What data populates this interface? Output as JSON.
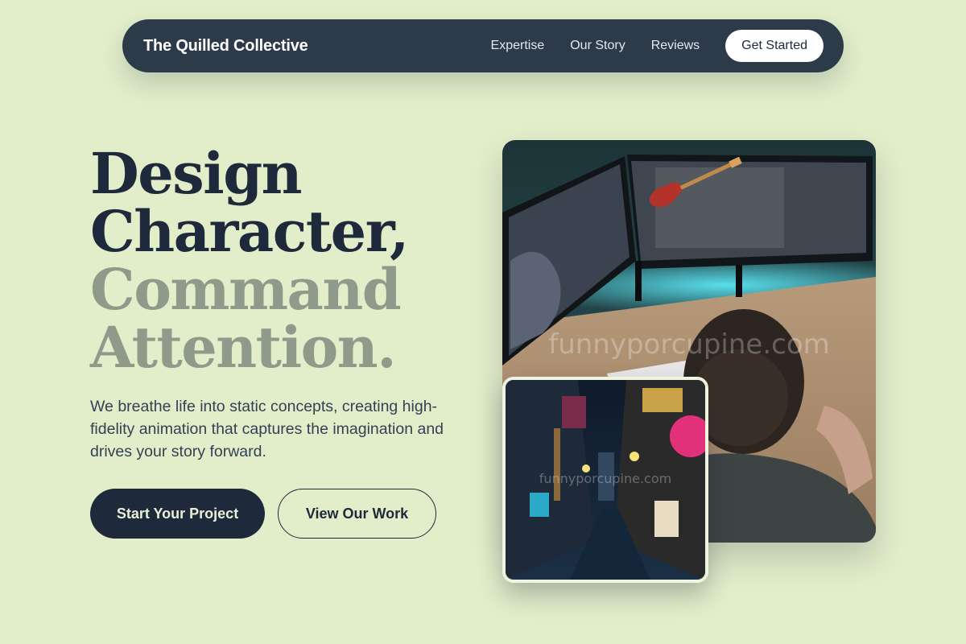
{
  "nav": {
    "brand": "The Quilled Collective",
    "links": [
      "Expertise",
      "Our Story",
      "Reviews"
    ],
    "cta": "Get Started"
  },
  "hero": {
    "headline_line1": "Design",
    "headline_line2": "Character,",
    "headline_line3": "Command",
    "headline_line4": "Attention.",
    "subtext": "We breathe life into static concepts, creating high-fidelity animation that captures the imagination and drives your story forward.",
    "primary_button": "Start Your Project",
    "secondary_button": "View Our Work"
  },
  "images": {
    "main_watermark": "funnyporcupine.com",
    "inset_watermark": "funnyporcupine.com"
  },
  "colors": {
    "background": "#e2edc9",
    "nav_bg": "#2d3a4a",
    "dark_text": "#1e293b",
    "muted_text": "#8e9a8a"
  }
}
